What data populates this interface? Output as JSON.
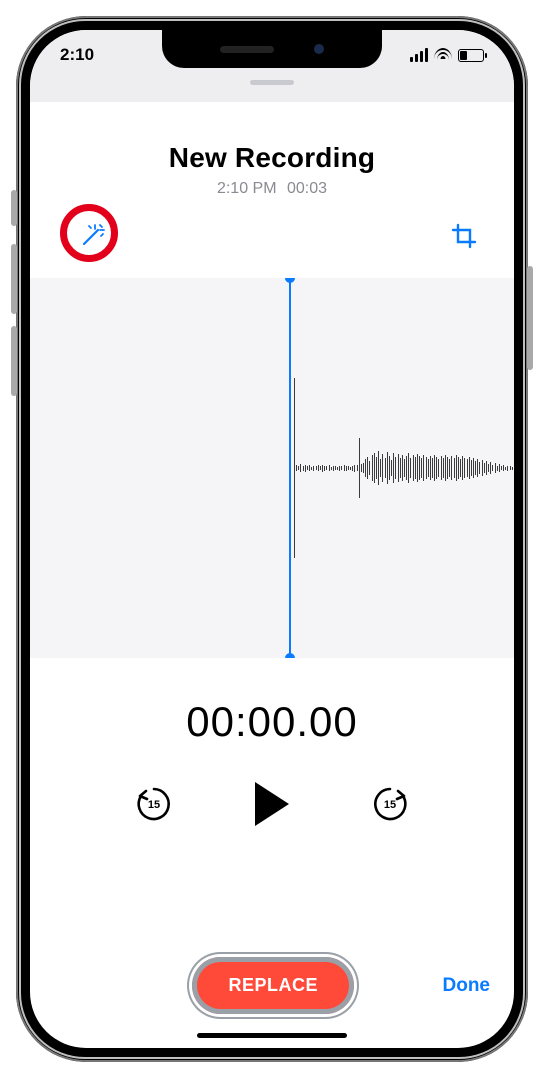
{
  "status": {
    "time": "2:10"
  },
  "recording": {
    "title": "New Recording",
    "timestamp": "2:10 PM",
    "duration": "00:03"
  },
  "playback": {
    "position": "00:00.00",
    "skip_seconds": "15"
  },
  "actions": {
    "replace": "REPLACE",
    "done": "Done"
  },
  "icons": {
    "enhance": "magic-wand-icon",
    "trim": "crop-icon",
    "skip_back": "skip-back-15-icon",
    "skip_fwd": "skip-forward-15-icon",
    "play": "play-icon"
  },
  "waveform_sample_heights": [
    180,
    6,
    4,
    8,
    5,
    7,
    4,
    6,
    3,
    5,
    4,
    6,
    4,
    7,
    5,
    4,
    6,
    3,
    5,
    4,
    3,
    5,
    4,
    6,
    5,
    4,
    3,
    5,
    7,
    6,
    60,
    8,
    10,
    18,
    22,
    14,
    26,
    30,
    22,
    34,
    18,
    28,
    20,
    32,
    24,
    16,
    30,
    22,
    28,
    20,
    26,
    18,
    24,
    30,
    20,
    26,
    22,
    28,
    24,
    20,
    26,
    22,
    18,
    24,
    20,
    26,
    22,
    18,
    24,
    20,
    26,
    22,
    18,
    24,
    20,
    26,
    22,
    18,
    24,
    20,
    18,
    22,
    16,
    20,
    14,
    18,
    12,
    16,
    10,
    14,
    8,
    12,
    6,
    10,
    5,
    8,
    4,
    6,
    3,
    5,
    4,
    3,
    4
  ]
}
